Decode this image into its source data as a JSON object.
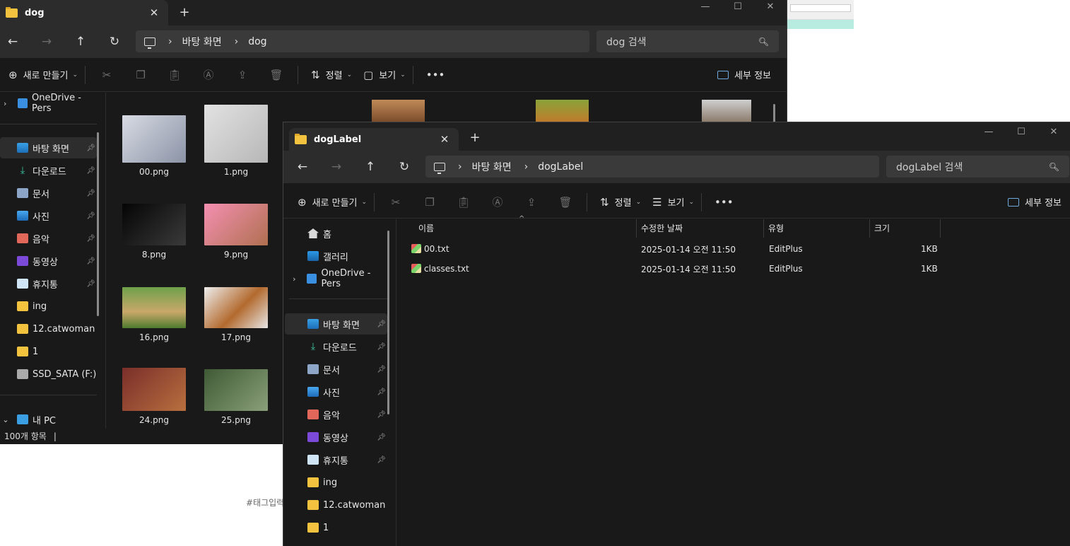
{
  "background": {
    "tag_text": "#태그입력"
  },
  "back_window": {
    "tab_title": "dog",
    "new_tab": "+",
    "window_controls": [
      "—",
      "☐",
      "✕"
    ],
    "breadcrumb": [
      "바탕 화면",
      "dog"
    ],
    "search_placeholder": "dog 검색",
    "toolbar": {
      "new_label": "새로 만들기",
      "sort_label": "정렬",
      "view_label": "보기",
      "details_label": "세부 정보"
    },
    "sidebar": [
      {
        "label": "OneDrive - Pers",
        "icon": "cloud-icon"
      },
      {
        "label": "바탕 화면",
        "icon": "desktop-icon",
        "pinned": true,
        "selected": true
      },
      {
        "label": "다운로드",
        "icon": "download-icon",
        "pinned": true
      },
      {
        "label": "문서",
        "icon": "document-icon",
        "pinned": true
      },
      {
        "label": "사진",
        "icon": "pictures-icon",
        "pinned": true
      },
      {
        "label": "음악",
        "icon": "music-icon",
        "pinned": true
      },
      {
        "label": "동영상",
        "icon": "videos-icon",
        "pinned": true
      },
      {
        "label": "휴지통",
        "icon": "recycle-bin-icon",
        "pinned": true
      },
      {
        "label": "ing",
        "icon": "folder-icon"
      },
      {
        "label": "12.catwoman",
        "icon": "folder-icon"
      },
      {
        "label": "1",
        "icon": "folder-icon"
      },
      {
        "label": "SSD_SATA (F:)",
        "icon": "drive-icon"
      },
      {
        "label": "내 PC",
        "icon": "pc-icon"
      }
    ],
    "thumbnails": [
      {
        "name": "00.png"
      },
      {
        "name": "1.png"
      },
      {
        "name": "8.png"
      },
      {
        "name": "9.png"
      },
      {
        "name": "16.png"
      },
      {
        "name": "17.png"
      },
      {
        "name": "24.png"
      },
      {
        "name": "25.png"
      }
    ],
    "status": "100개 항목"
  },
  "front_window": {
    "tab_title": "dogLabel",
    "new_tab": "+",
    "window_controls": [
      "—",
      "☐",
      "✕"
    ],
    "breadcrumb": [
      "바탕 화면",
      "dogLabel"
    ],
    "search_placeholder": "dogLabel 검색",
    "toolbar": {
      "new_label": "새로 만들기",
      "sort_label": "정렬",
      "view_label": "보기",
      "details_label": "세부 정보"
    },
    "sidebar": [
      {
        "label": "홈",
        "icon": "home-icon"
      },
      {
        "label": "갤러리",
        "icon": "gallery-icon"
      },
      {
        "label": "OneDrive - Pers",
        "icon": "cloud-icon"
      },
      {
        "label": "바탕 화면",
        "icon": "desktop-icon",
        "pinned": true,
        "selected": true
      },
      {
        "label": "다운로드",
        "icon": "download-icon",
        "pinned": true
      },
      {
        "label": "문서",
        "icon": "document-icon",
        "pinned": true
      },
      {
        "label": "사진",
        "icon": "pictures-icon",
        "pinned": true
      },
      {
        "label": "음악",
        "icon": "music-icon",
        "pinned": true
      },
      {
        "label": "동영상",
        "icon": "videos-icon",
        "pinned": true
      },
      {
        "label": "휴지통",
        "icon": "recycle-bin-icon",
        "pinned": true
      },
      {
        "label": "ing",
        "icon": "folder-icon"
      },
      {
        "label": "12.catwoman",
        "icon": "folder-icon"
      },
      {
        "label": "1",
        "icon": "folder-icon"
      }
    ],
    "columns": [
      "이름",
      "수정한 날짜",
      "유형",
      "크기"
    ],
    "files": [
      {
        "name": "00.txt",
        "modified": "2025-01-14 오전 11:50",
        "type": "EditPlus",
        "size": "1KB"
      },
      {
        "name": "classes.txt",
        "modified": "2025-01-14 오전 11:50",
        "type": "EditPlus",
        "size": "1KB"
      }
    ]
  }
}
